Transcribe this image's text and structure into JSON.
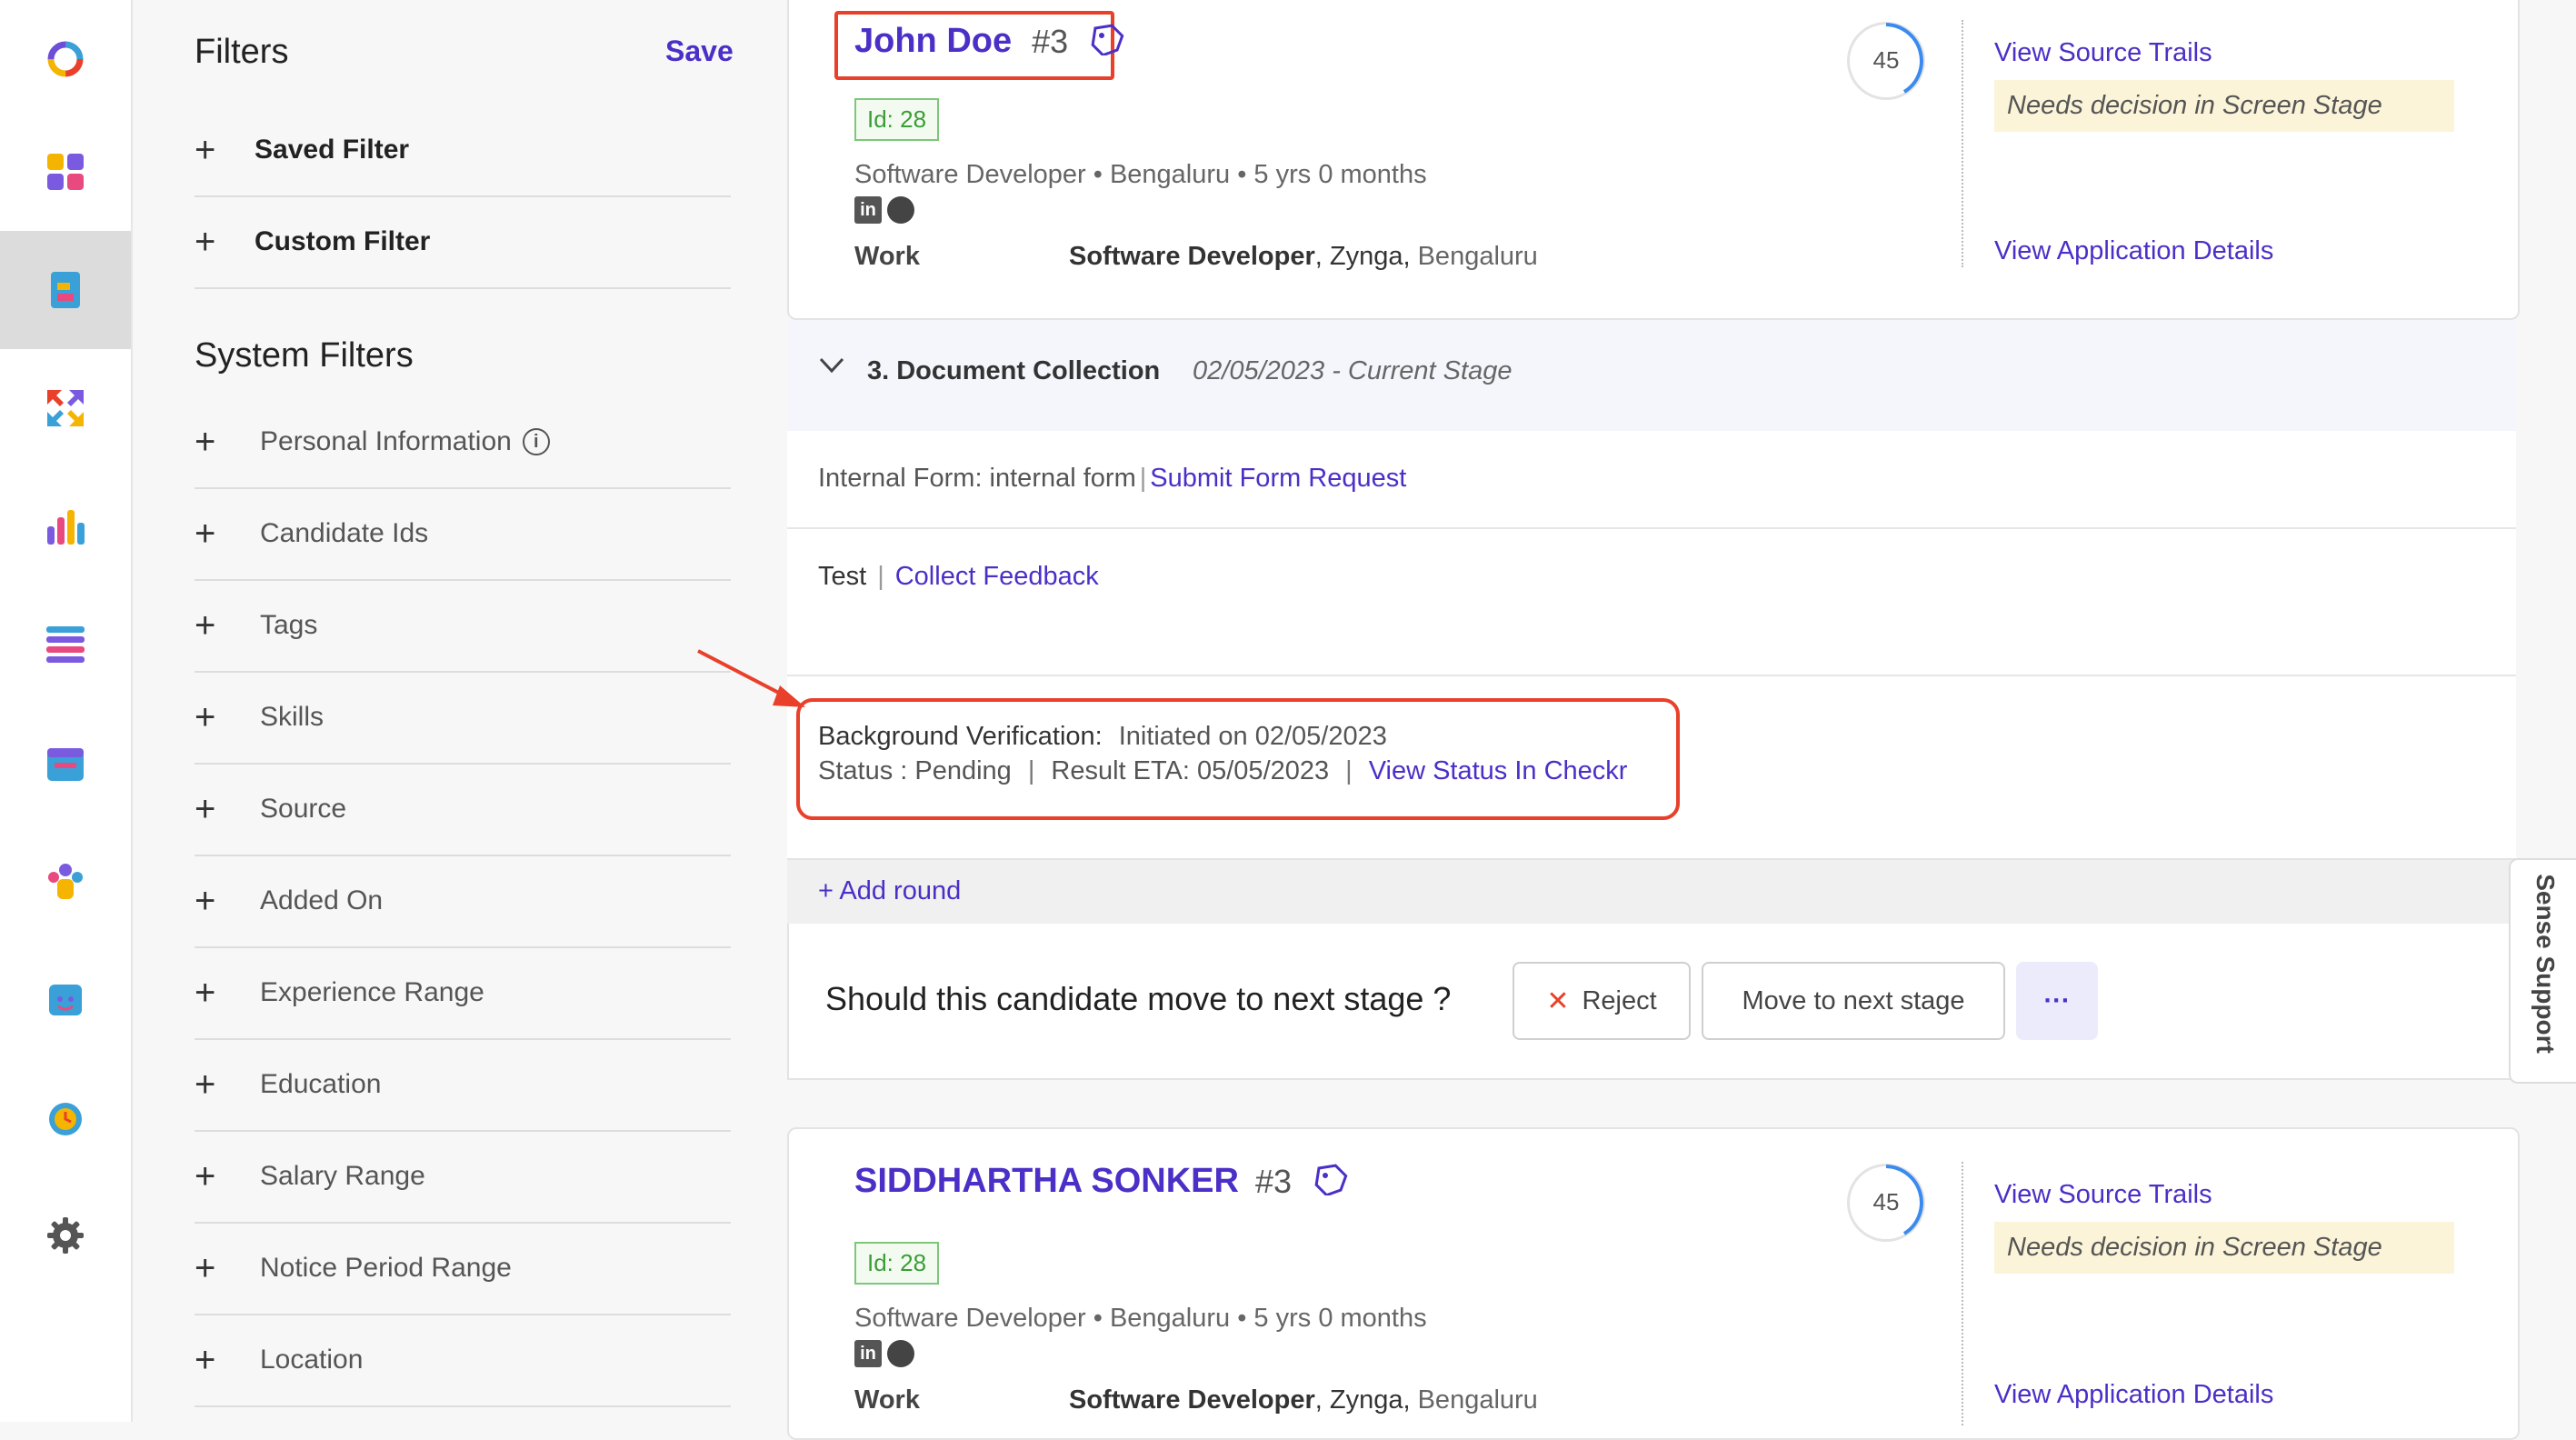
{
  "filters": {
    "title": "Filters",
    "save": "Save",
    "top_items": [
      "Saved Filter",
      "Custom Filter"
    ],
    "system_title": "System Filters",
    "system_items": [
      "Personal Information",
      "Candidate Ids",
      "Tags",
      "Skills",
      "Source",
      "Added On",
      "Experience Range",
      "Education",
      "Salary Range",
      "Notice Period Range",
      "Location"
    ]
  },
  "candidate1": {
    "name": "John Doe",
    "number": "#3",
    "score": "45",
    "id_tag": "Id: 28",
    "summary": "Software Developer • Bengaluru • 5 yrs 0 months",
    "work_label": "Work",
    "work_role": "Software Developer",
    "work_rest": ", Zynga, ",
    "work_city": "Bengaluru",
    "source_trails": "View Source Trails",
    "decision": "Needs decision in Screen Stage",
    "app_details": "View Application Details"
  },
  "stage": {
    "title": "3. Document Collection",
    "date": "02/05/2023 - Current Stage",
    "form_label": "Internal Form: internal form",
    "form_link": "Submit Form Request",
    "test_label": "Test",
    "test_link": "Collect Feedback",
    "bg_label": "Background Verification:",
    "bg_initiated": "Initiated on 02/05/2023",
    "bg_status": "Status : Pending",
    "bg_eta": "Result ETA: 05/05/2023",
    "bg_link": "View Status In Checkr",
    "add_round": "+ Add round",
    "question": "Should this candidate move to next stage ?",
    "reject": "Reject",
    "move_next": "Move to next stage",
    "more": "···"
  },
  "candidate2": {
    "name": "SIDDHARTHA SONKER",
    "number": "#3",
    "score": "45",
    "id_tag": "Id: 28",
    "summary": "Software Developer • Bengaluru • 5 yrs 0 months",
    "work_label": "Work",
    "work_role": "Software Developer",
    "work_rest": ", Zynga, ",
    "work_city": "Bengaluru",
    "source_trails": "View Source Trails",
    "decision": "Needs decision in Screen Stage",
    "app_details": "View Application Details"
  },
  "support": "Sense Support",
  "colors": {
    "accent": "#4b2fc7",
    "highlight": "#e8402b",
    "tag_green": "#3a9d36"
  }
}
